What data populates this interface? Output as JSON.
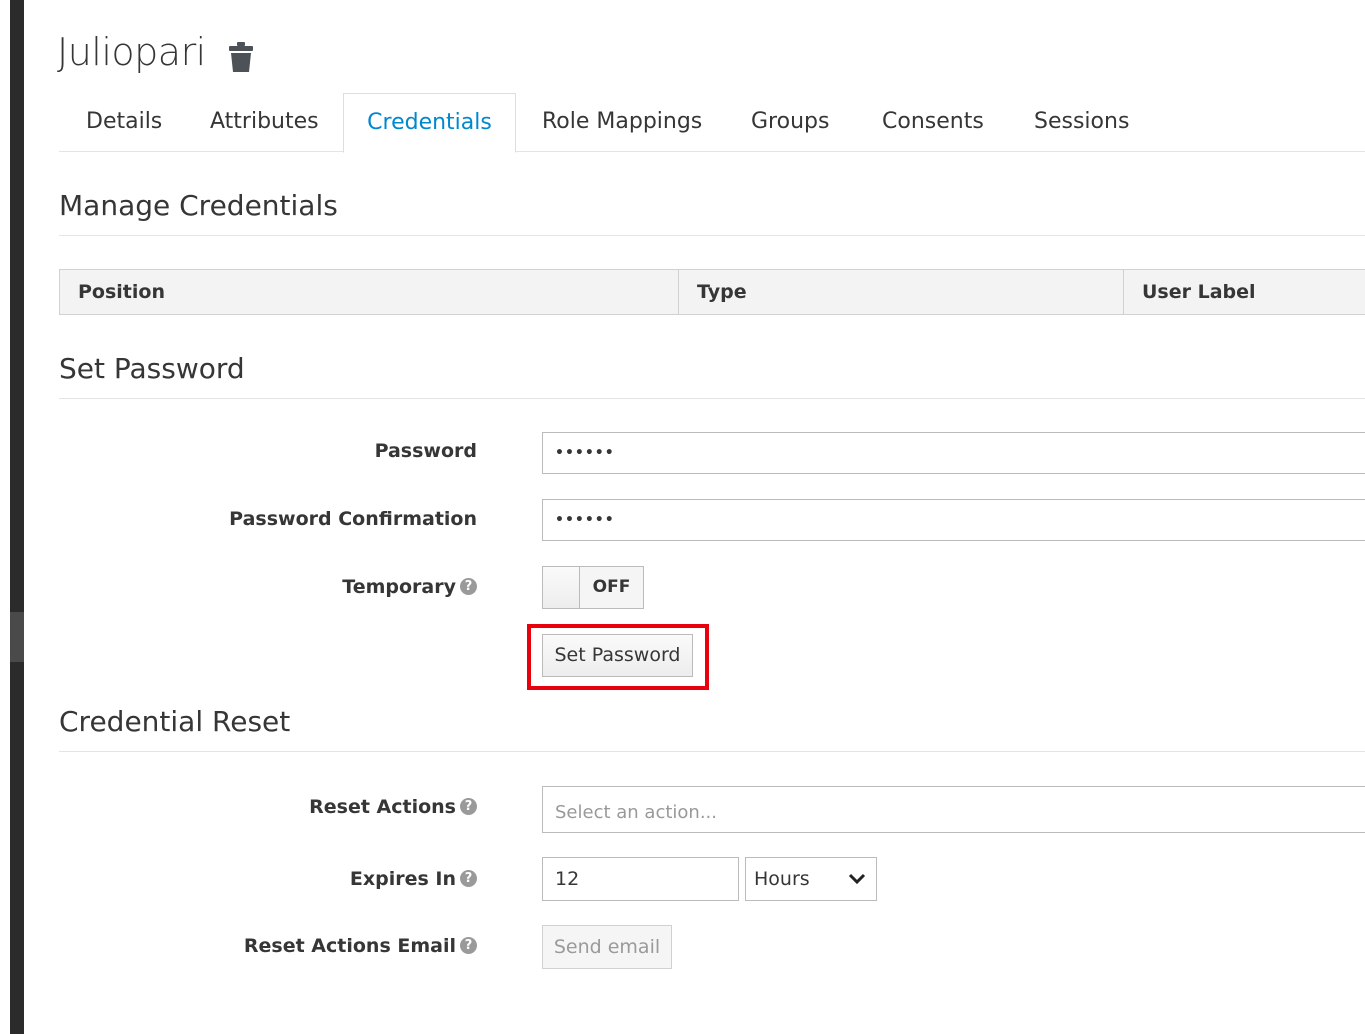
{
  "user": {
    "name": "Juliopari"
  },
  "tabs": [
    {
      "label": "Details"
    },
    {
      "label": "Attributes"
    },
    {
      "label": "Credentials"
    },
    {
      "label": "Role Mappings"
    },
    {
      "label": "Groups"
    },
    {
      "label": "Consents"
    },
    {
      "label": "Sessions"
    }
  ],
  "active_tab": "Credentials",
  "manage": {
    "title": "Manage Credentials",
    "columns": [
      "Position",
      "Type",
      "User Label"
    ]
  },
  "set_password": {
    "title": "Set Password",
    "password_label": "Password",
    "password_value": "••••••",
    "confirm_label": "Password Confirmation",
    "confirm_value": "••••••",
    "temporary_label": "Temporary",
    "temporary_state": "OFF",
    "button_label": "Set Password"
  },
  "reset": {
    "title": "Credential Reset",
    "actions_label": "Reset Actions",
    "actions_placeholder": "Select an action...",
    "expires_label": "Expires In",
    "expires_value": "12",
    "expires_unit": "Hours",
    "email_label": "Reset Actions Email",
    "email_button": "Send email"
  },
  "colors": {
    "accent": "#0088ce",
    "highlight": "#e8000c",
    "text": "#363636"
  }
}
